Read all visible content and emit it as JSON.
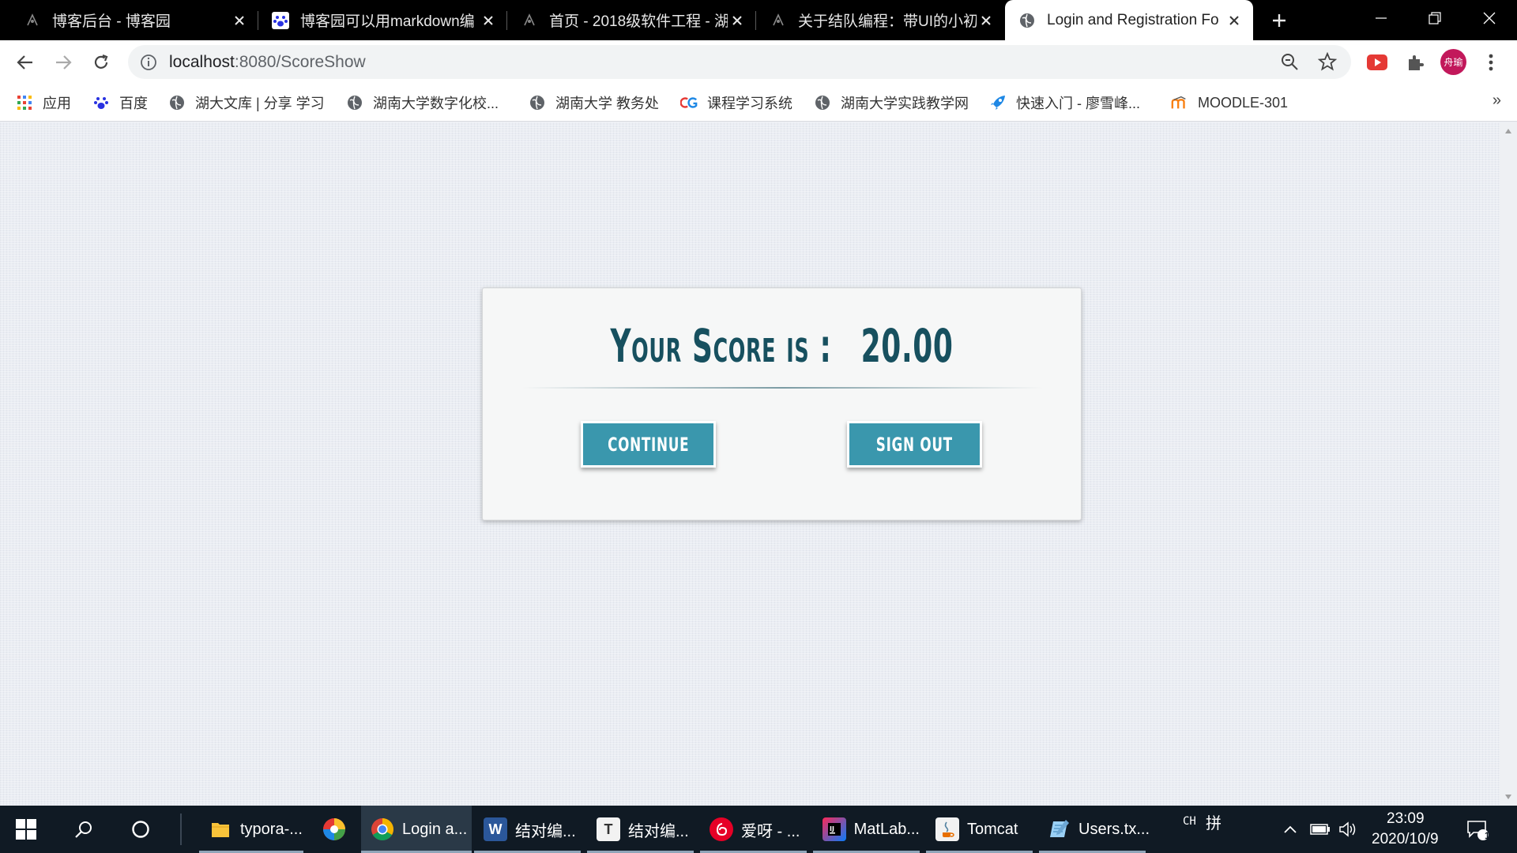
{
  "browser": {
    "tabs": [
      {
        "title": "博客后台 - 博客园",
        "icon": "cnblogs-icon",
        "active": false
      },
      {
        "title": "博客园可以用markdown编",
        "icon": "baidu-paw-icon",
        "active": false
      },
      {
        "title": "首页 - 2018级软件工程 - 湖",
        "icon": "cnblogs-icon",
        "active": false
      },
      {
        "title": "关于结队编程：带UI的小初",
        "icon": "cnblogs-icon",
        "active": false
      },
      {
        "title": "Login and Registration Fo",
        "icon": "globe-icon",
        "active": true
      }
    ],
    "address": {
      "host": "localhost",
      "path": ":8080/ScoreShow"
    },
    "avatar_text": "舟瑜",
    "bookmarks": [
      {
        "label": "应用",
        "icon": "apps-grid-icon"
      },
      {
        "label": "百度",
        "icon": "baidu-paw-icon"
      },
      {
        "label": "湖大文库 | 分享 学习",
        "icon": "globe-icon"
      },
      {
        "label": "湖南大学数字化校...",
        "icon": "globe-icon"
      },
      {
        "label": "湖南大学 教务处",
        "icon": "globe-icon"
      },
      {
        "label": "课程学习系统",
        "icon": "cg-logo-icon"
      },
      {
        "label": "湖南大学实践教学网",
        "icon": "globe-icon"
      },
      {
        "label": "快速入门 - 廖雪峰...",
        "icon": "rocket-icon"
      },
      {
        "label": "MOODLE-301",
        "icon": "moodle-icon"
      }
    ],
    "bookmarks_more": "»"
  },
  "card": {
    "score_label": "Your Score is :",
    "score_value": "20.00",
    "continue_label": "CONTINUE",
    "signout_label": "SIGN OUT"
  },
  "taskbar": {
    "apps": [
      {
        "label": "typora-...",
        "icon": "folder-icon"
      },
      {
        "label": "",
        "icon": "color-wheel-icon"
      },
      {
        "label": "Login a...",
        "icon": "chrome-icon",
        "active": true
      },
      {
        "label": "结对编...",
        "icon": "word-icon"
      },
      {
        "label": "结对编...",
        "icon": "typora-icon"
      },
      {
        "label": "爱呀 - ...",
        "icon": "netease-music-icon"
      },
      {
        "label": "MatLab...",
        "icon": "intellij-icon"
      },
      {
        "label": "Tomcat",
        "icon": "java-icon"
      },
      {
        "label": "Users.tx...",
        "icon": "notepad-icon"
      }
    ],
    "ime_lang": "CH",
    "ime_mode": "拼",
    "time": "23:09",
    "date": "2020/10/9",
    "notification_count": "1"
  },
  "colors": {
    "accent_button": "#3a97ad",
    "score_text": "#17505f"
  }
}
